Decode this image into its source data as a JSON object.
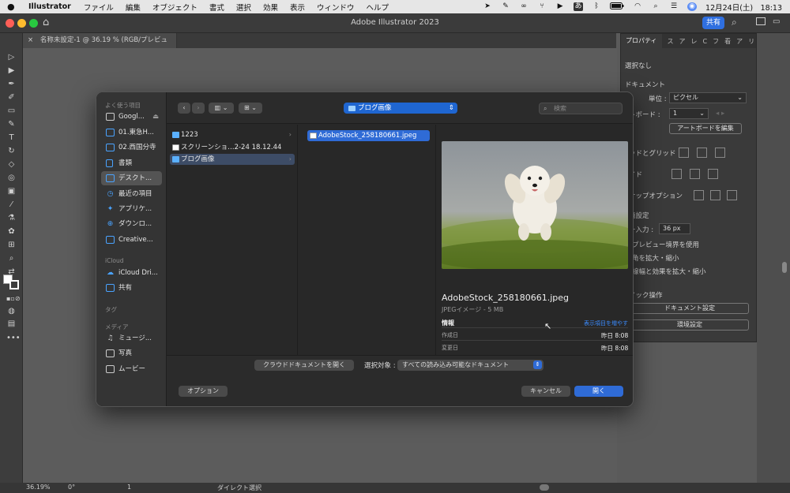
{
  "menubar": {
    "app_name": "Illustrator",
    "items": [
      "ファイル",
      "編集",
      "オブジェクト",
      "書式",
      "選択",
      "効果",
      "表示",
      "ウィンドウ",
      "ヘルプ"
    ],
    "clock": "12月24日(土)　18:13"
  },
  "titlebar": {
    "title": "Adobe Illustrator 2023",
    "share_label": "共有"
  },
  "document_tab": {
    "close": "×",
    "label": "名称未設定-1 @ 36.19 % (RGB/プレビュー)"
  },
  "properties_panel": {
    "tabs": [
      "プロパティ",
      "ス",
      "ア",
      "レ",
      "C",
      "フ",
      "看",
      "ア",
      "リ"
    ],
    "selection": "選択なし",
    "document_heading": "ドキュメント",
    "unit_label": "単位 :",
    "unit_value": "ピクセル",
    "artboard_label": "トボード :",
    "artboard_value": "1",
    "edit_artboard_button": "アートボードを編集",
    "grid_label": "ッドとグリッド",
    "guide_label": "イド",
    "snap_label": "ナップオプション",
    "env_label": "境設定",
    "key_input_label": "ー入力 :",
    "key_input_value": "36 px",
    "check1": "プレビュー境界を使用",
    "check2": "角を拡大・縮小",
    "check3": "線幅と効果を拡大・縮小",
    "quick_actions_label": "イック操作",
    "doc_settings_button": "ドキュメント設定",
    "preferences_button": "環境設定"
  },
  "status_bar": {
    "zoom": "36.19%",
    "rotation": "0°",
    "artboard": "1",
    "tool": "ダイレクト選択"
  },
  "dialog": {
    "sidebar": {
      "favorites_heading": "よく使う項目",
      "favorites": [
        {
          "label": "Googl...",
          "icon": "drive-icon"
        },
        {
          "label": "01.東急H...",
          "icon": "folder-icon"
        },
        {
          "label": "02.西国分寺",
          "icon": "folder-icon"
        },
        {
          "label": "書類",
          "icon": "document-icon"
        },
        {
          "label": "デスクト...",
          "icon": "desktop-icon"
        },
        {
          "label": "最近の項目",
          "icon": "clock-icon"
        },
        {
          "label": "アプリケ...",
          "icon": "apps-icon"
        },
        {
          "label": "ダウンロ...",
          "icon": "download-icon"
        },
        {
          "label": "Creative...",
          "icon": "folder-icon"
        }
      ],
      "icloud_heading": "iCloud",
      "icloud": [
        {
          "label": "iCloud Dri...",
          "icon": "cloud-icon"
        },
        {
          "label": "共有",
          "icon": "shared-folder-icon"
        }
      ],
      "tags_heading": "タグ",
      "media_heading": "メディア",
      "media": [
        {
          "label": "ミュージ...",
          "icon": "music-icon"
        },
        {
          "label": "写真",
          "icon": "camera-icon"
        },
        {
          "label": "ムービー",
          "icon": "film-icon"
        }
      ]
    },
    "path_popup": "ブログ画像",
    "search_placeholder": "検索",
    "column1": [
      {
        "name": "1223",
        "kind": "folder"
      },
      {
        "name": "スクリーンショ…2-24 18.12.44",
        "kind": "screenshot"
      },
      {
        "name": "ブログ画像",
        "kind": "folder"
      }
    ],
    "column2": [
      {
        "name": "AdobeStock_258180661.jpeg"
      }
    ],
    "preview": {
      "filename": "AdobeStock_258180661.jpeg",
      "kind": "JPEGイメージ - 5 MB",
      "info_heading": "情報",
      "show_more": "表示項目を増やす",
      "created_label": "作成日",
      "created_value": "昨日 8:08",
      "modified_label": "変更日",
      "modified_value": "昨日 8:08"
    },
    "cloud_button": "クラウドドキュメントを開く",
    "enable_label": "選択対象 :",
    "enable_value": "すべての読み込み可能なドキュメント",
    "options_button": "オプション",
    "cancel_button": "キャンセル",
    "open_button": "開く"
  }
}
